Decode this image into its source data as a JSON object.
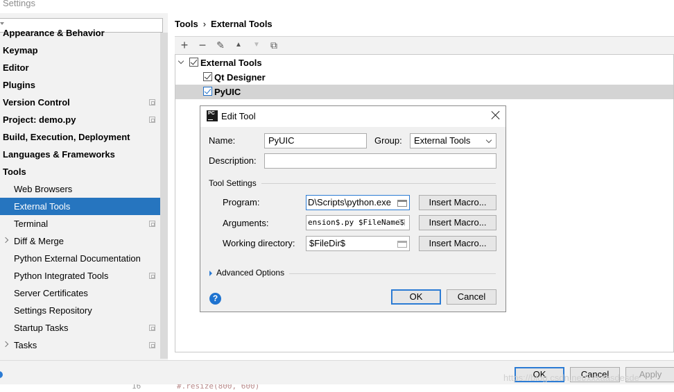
{
  "window": {
    "title": "Settings"
  },
  "sidebar": {
    "search_placeholder": "",
    "items": [
      {
        "label": "Appearance & Behavior",
        "bold": true
      },
      {
        "label": "Keymap",
        "bold": true
      },
      {
        "label": "Editor",
        "bold": true
      },
      {
        "label": "Plugins",
        "bold": true
      },
      {
        "label": "Version Control",
        "bold": true,
        "project_icon": true
      },
      {
        "label": "Project: demo.py",
        "bold": true,
        "project_icon": true
      },
      {
        "label": "Build, Execution, Deployment",
        "bold": true
      },
      {
        "label": "Languages & Frameworks",
        "bold": true
      },
      {
        "label": "Tools",
        "bold": true
      },
      {
        "label": "Web Browsers",
        "child": true
      },
      {
        "label": "External Tools",
        "child": true,
        "selected": true
      },
      {
        "label": "Terminal",
        "child": true,
        "project_icon": true
      },
      {
        "label": "Diff & Merge",
        "child": true,
        "expandable": true
      },
      {
        "label": "Python External Documentation",
        "child": true
      },
      {
        "label": "Python Integrated Tools",
        "child": true,
        "project_icon": true
      },
      {
        "label": "Server Certificates",
        "child": true
      },
      {
        "label": "Settings Repository",
        "child": true
      },
      {
        "label": "Startup Tasks",
        "child": true,
        "project_icon": true
      },
      {
        "label": "Tasks",
        "child": true,
        "expandable": true,
        "project_icon": true
      }
    ]
  },
  "main": {
    "breadcrumb": {
      "parent": "Tools",
      "separator": "›",
      "current": "External Tools"
    },
    "toolbar": {
      "add": "+",
      "remove": "−",
      "edit": "✎",
      "up": "▲",
      "down": "▼",
      "copy": "⧉"
    },
    "tree": {
      "group": "External Tools",
      "tools": [
        "Qt Designer",
        "PyUIC"
      ]
    }
  },
  "dialog": {
    "title": "Edit Tool",
    "name_label": "Name:",
    "name_value": "PyUIC",
    "group_label": "Group:",
    "group_value": "External Tools",
    "description_label": "Description:",
    "description_value": "",
    "tool_settings_label": "Tool Settings",
    "program_label": "Program:",
    "program_value": "D\\Scripts\\python.exe",
    "arguments_label": "Arguments:",
    "arguments_value": "ension$.py $FileName$",
    "workdir_label": "Working directory:",
    "workdir_value": "$FileDir$",
    "insert_macro": "Insert Macro...",
    "advanced_label": "Advanced Options",
    "ok": "OK",
    "cancel": "Cancel",
    "help": "?"
  },
  "bottom": {
    "ok": "OK",
    "cancel": "Cancel",
    "apply": "Apply",
    "watermark": "https://blog.csdn.net/xxxaasdesde",
    "strip_left": "16",
    "strip_code": "#.resize(800, 600)"
  },
  "colors": {
    "selection": "#2675bf",
    "accent": "#2b7bd4"
  }
}
